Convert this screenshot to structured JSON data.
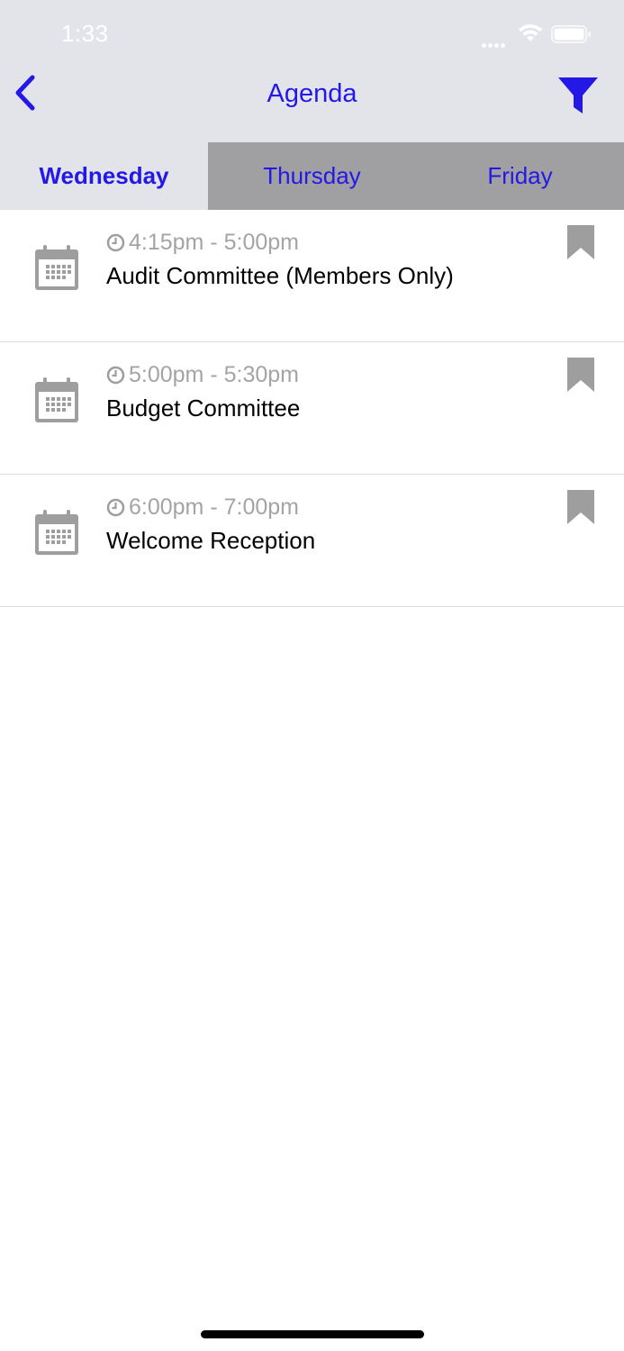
{
  "status_bar": {
    "time": "1:33"
  },
  "nav": {
    "title": "Agenda",
    "back_icon": "chevron-left-icon",
    "filter_icon": "filter-icon"
  },
  "tabs": [
    {
      "label": "Wednesday",
      "active": true
    },
    {
      "label": "Thursday",
      "active": false
    },
    {
      "label": "Friday",
      "active": false
    }
  ],
  "agenda": {
    "items": [
      {
        "time": "4:15pm - 5:00pm",
        "title": "Audit Committee (Members Only)"
      },
      {
        "time": "5:00pm - 5:30pm",
        "title": "Budget Committee"
      },
      {
        "time": "6:00pm - 7:00pm",
        "title": "Welcome Reception"
      }
    ]
  },
  "colors": {
    "accent": "#2418e6",
    "header_bg": "#e3e4e9",
    "inactive_tab_bg": "#a0a0a3",
    "muted_text": "#a4a4a4",
    "icon_gray": "#9e9e9e"
  }
}
